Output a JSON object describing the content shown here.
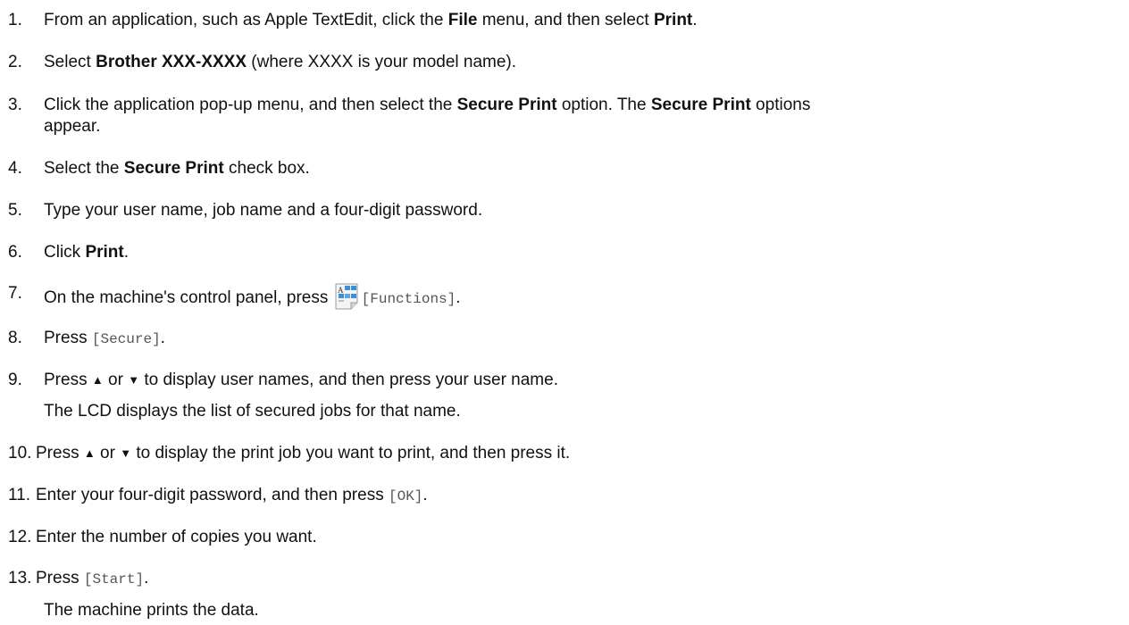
{
  "steps": [
    {
      "n": "1.",
      "parts": [
        "From an application, such as Apple TextEdit, click the ",
        "File",
        " menu, and then select ",
        "Print",
        "."
      ]
    },
    {
      "n": "2.",
      "parts": [
        "Select ",
        "Brother XXX-XXXX",
        " (where XXXX is your model name)."
      ]
    },
    {
      "n": "3.",
      "parts": [
        "Click the application pop-up menu, and then select the ",
        "Secure Print",
        " option. The ",
        "Secure Print",
        " options",
        "appear."
      ]
    },
    {
      "n": "4.",
      "parts": [
        "Select the ",
        "Secure Print",
        " check box."
      ]
    },
    {
      "n": "5.",
      "parts": [
        "Type your user name, job name and a four-digit password."
      ]
    },
    {
      "n": "6.",
      "parts": [
        "Click ",
        "Print",
        "."
      ]
    },
    {
      "n": "7.",
      "parts": [
        "On the machine's control panel, press ",
        "[Functions]",
        "."
      ]
    },
    {
      "n": "8.",
      "parts": [
        "Press ",
        "[Secure]",
        "."
      ]
    },
    {
      "n": "9.",
      "parts": [
        "Press ",
        "▲",
        " or ",
        "▼",
        " to display user names, and then press your user name."
      ],
      "sub": "The LCD displays the list of secured jobs for that name."
    },
    {
      "n": "10.",
      "parts": [
        "Press ",
        "▲",
        " or ",
        "▼",
        " to display the print job you want to print, and then press it."
      ]
    },
    {
      "n": "11.",
      "parts": [
        "Enter your four-digit password, and then press ",
        "[OK]",
        "."
      ]
    },
    {
      "n": "12.",
      "parts": [
        "Enter the number of copies you want."
      ]
    },
    {
      "n": "13.",
      "parts": [
        "Press ",
        "[Start]",
        "."
      ],
      "sub": "The machine prints the data."
    }
  ],
  "icons": {
    "functions": "functions-icon"
  },
  "colors": {
    "icon_blue": "#3a8fd6",
    "icon_paper": "#f4f4f4",
    "mono_text": "#555555"
  }
}
